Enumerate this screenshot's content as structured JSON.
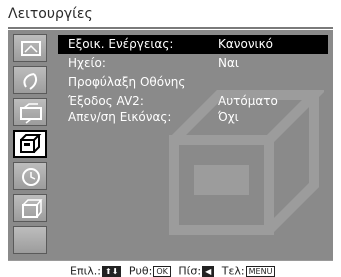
{
  "title": "Λειτουργίες",
  "sidebar": {
    "items": [
      {
        "icon": "picture-icon"
      },
      {
        "icon": "sound-icon"
      },
      {
        "icon": "screen-icon"
      },
      {
        "icon": "features-icon"
      },
      {
        "icon": "timer-icon"
      },
      {
        "icon": "setup-icon"
      },
      {
        "icon": "blank-icon"
      }
    ],
    "selected_index": 3
  },
  "menu": {
    "items": [
      {
        "label": "Εξοικ. Ενέργειας:",
        "value": "Κανονικό"
      },
      {
        "label": "Ηχείο:",
        "value": "Ναι"
      },
      {
        "label": "Προφύλαξη Οθόνης",
        "value": ""
      },
      {
        "label": "Έξοδος AV2:",
        "value": "Αυτόματο"
      },
      {
        "label": "Απεν/ση Εικόνας:",
        "value": "Όχι"
      }
    ],
    "highlighted_index": 0
  },
  "footer": {
    "select_label": "Επιλ.:",
    "select_key": "⬆⬇",
    "set_label": "Ρυθ:",
    "set_key": "OK",
    "back_label": "Πίσ:",
    "back_key": "◀",
    "end_label": "Τελ:",
    "end_key": "MENU"
  }
}
